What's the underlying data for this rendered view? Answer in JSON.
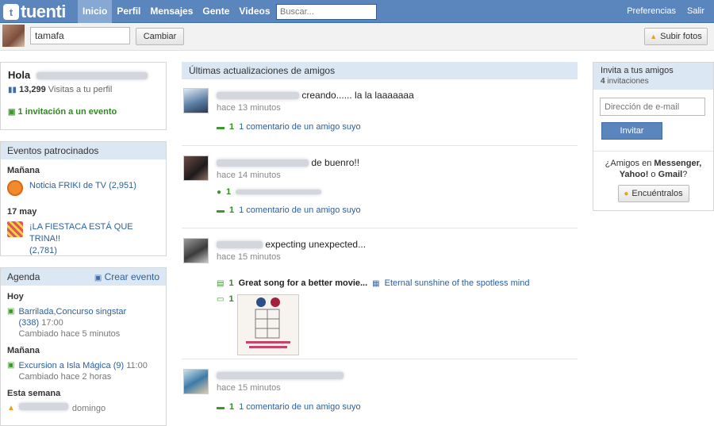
{
  "topbar": {
    "logo": "tuenti",
    "nav": [
      "Inicio",
      "Perfil",
      "Mensajes",
      "Gente",
      "Videos"
    ],
    "search_placeholder": "Buscar...",
    "right": [
      "Preferencias",
      "Salir"
    ]
  },
  "status": {
    "value": "tamafa",
    "cambiar": "Cambiar",
    "subir": "Subir fotos"
  },
  "profile": {
    "hola": "Hola",
    "visits_count": "13,299",
    "visits_label": "Visitas a tu perfil",
    "invite_count": "1",
    "invite_label": "invitación a un evento"
  },
  "sponsored": {
    "title": "Eventos patrocinados",
    "groups": [
      {
        "day": "Mañana",
        "name": "Noticia FRIKI de TV",
        "count": "(2,951)"
      },
      {
        "day": "17 may",
        "name": "¡LA FIESTACA ESTÁ QUE TRINA!!",
        "count": "(2,781)"
      }
    ]
  },
  "agenda": {
    "title": "Agenda",
    "create": "Crear evento",
    "sections": [
      {
        "day": "Hoy",
        "name": "Barrilada,Concurso singstar",
        "count": "(338)",
        "time": "17:00",
        "changed": "Cambiado hace 5 minutos"
      },
      {
        "day": "Mañana",
        "name": "Excursion a Isla Mágica",
        "count": "(9)",
        "time": "11:00",
        "changed": "Cambiado hace 2 horas"
      },
      {
        "day": "Esta semana",
        "name": "",
        "count": "",
        "time": "domingo",
        "changed": ""
      }
    ]
  },
  "feed": {
    "title": "Últimas actualizaciones de amigos",
    "items": [
      {
        "text": "creando...... la la laaaaaaa",
        "time": "hace 13 minutos",
        "count": "1",
        "action": "1 comentario de un amigo suyo"
      },
      {
        "text": "de buenro!!",
        "time": "hace 14 minutos",
        "count_extra": "1",
        "count": "1",
        "action": "1 comentario de un amigo suyo"
      },
      {
        "text": "expecting unexpected...",
        "time": "hace 15 minutos",
        "song_count": "1",
        "song": "Great song for a better movie...",
        "movie": "Eternal sunshine of the spotless mind",
        "photo_count": "1"
      },
      {
        "text": "",
        "time": "hace 15 minutos",
        "count": "1",
        "action": "1 comentario de un amigo suyo"
      }
    ]
  },
  "invite": {
    "title": "Invita a tus amigos",
    "count": "4",
    "count_label": "invitaciones",
    "email_placeholder": "Dirección de e-mail",
    "button": "Invitar",
    "msg_a": "¿Amigos en",
    "msg_b": "Messenger,",
    "msg_c": "Yahoo!",
    "msg_d": "o",
    "msg_e": "Gmail",
    "msg_f": "?",
    "find": "Encuéntralos"
  },
  "colors": {
    "brand": "#5b86bd",
    "section": "#dbe7f3",
    "link": "#2a5f9e",
    "green": "#2e8a1f"
  }
}
